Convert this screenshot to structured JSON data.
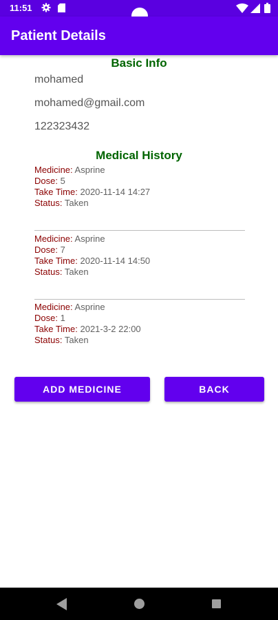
{
  "status_bar": {
    "time": "11:51",
    "icons": [
      "gear-icon",
      "sd-card-icon",
      "wifi-icon",
      "signal-icon",
      "battery-icon"
    ]
  },
  "app_bar": {
    "title": "Patient Details"
  },
  "basic_info": {
    "heading": "Basic Info",
    "name": "mohamed",
    "email": "mohamed@gmail.com",
    "phone": "122323432"
  },
  "medical_history": {
    "heading": "Medical History",
    "records": [
      {
        "medicine_label": "Medicine:",
        "medicine": "Asprine",
        "dose_label": "Dose:",
        "dose": "5",
        "time_label": "Take Time:",
        "time": "2020-11-14 14:27",
        "status_label": "Status:",
        "status": "Taken"
      },
      {
        "medicine_label": "Medicine:",
        "medicine": "Asprine",
        "dose_label": "Dose:",
        "dose": "7",
        "time_label": "Take Time:",
        "time": "2020-11-14 14:50",
        "status_label": "Status:",
        "status": "Taken"
      },
      {
        "medicine_label": "Medicine:",
        "medicine": "Asprine",
        "dose_label": "Dose:",
        "dose": "1",
        "time_label": "Take Time:",
        "time": "2021-3-2 22:00",
        "status_label": "Status:",
        "status": "Taken"
      }
    ]
  },
  "actions": {
    "add_medicine": "ADD MEDICINE",
    "back": "BACK"
  },
  "navigation": {
    "icons": [
      "back-icon",
      "home-icon",
      "recents-icon"
    ]
  },
  "colors": {
    "primary": "#6200ee",
    "status_bar": "#5a00e0",
    "heading": "#006400",
    "label": "#8b0000",
    "value": "#616161"
  }
}
